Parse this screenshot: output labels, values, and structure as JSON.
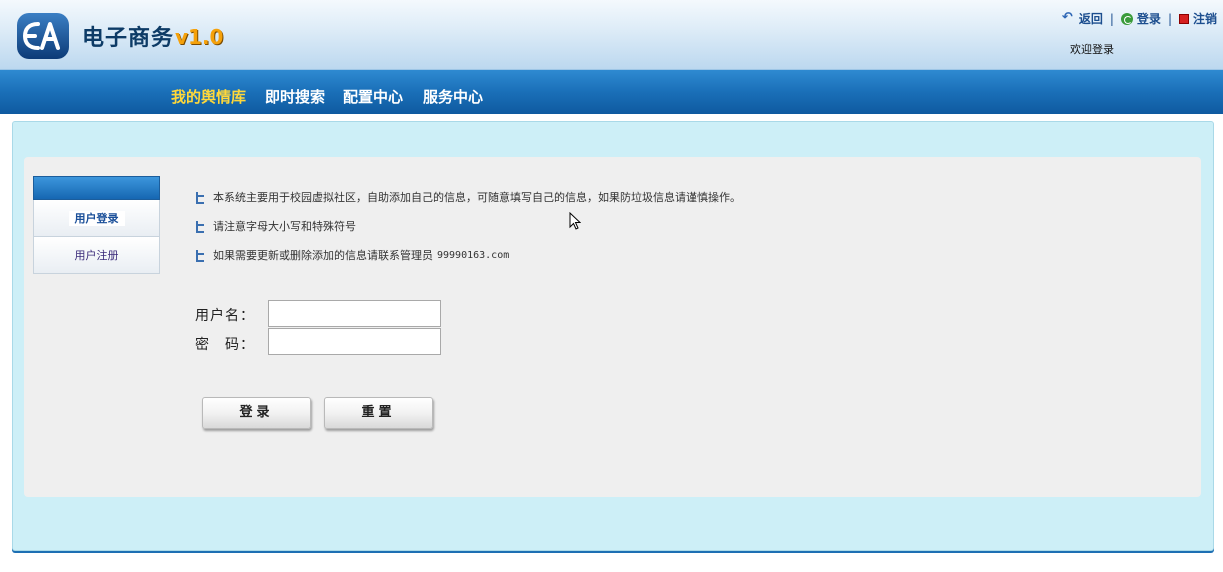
{
  "header": {
    "logo_text": "电子商务",
    "version": "v1.0",
    "links": [
      {
        "label": "返回",
        "icon": "back-arrow-icon"
      },
      {
        "label": "登录",
        "icon": "login-icon"
      },
      {
        "label": "注销",
        "icon": "logout-icon"
      }
    ],
    "welcome": "欢迎登录"
  },
  "nav": {
    "items": [
      "我的舆情库",
      "即时搜索",
      "配置中心",
      "服务中心"
    ],
    "active_index": 0
  },
  "sidebar": {
    "items": [
      "用户登录",
      "用户注册"
    ]
  },
  "notes": [
    "本系统主要用于校园虚拟社区，自助添加自己的信息，可随意填写自己的信息，如果防垃圾信息请谨慎操作。",
    "请注意字母大小写和特殊符号",
    "如果需要更新或删除添加的信息请联系管理员"
  ],
  "admin_email": "99990163.com",
  "form": {
    "username_label": "用户名：",
    "password_label": "密　码：",
    "username_value": "",
    "password_value": "",
    "login_button": "登录",
    "reset_button": "重置"
  },
  "colors": {
    "nav_active": "#ffd83a",
    "nav_bg": "#1a6fb8",
    "panel_bg": "#cdeff7",
    "content_bg": "#efefef"
  }
}
